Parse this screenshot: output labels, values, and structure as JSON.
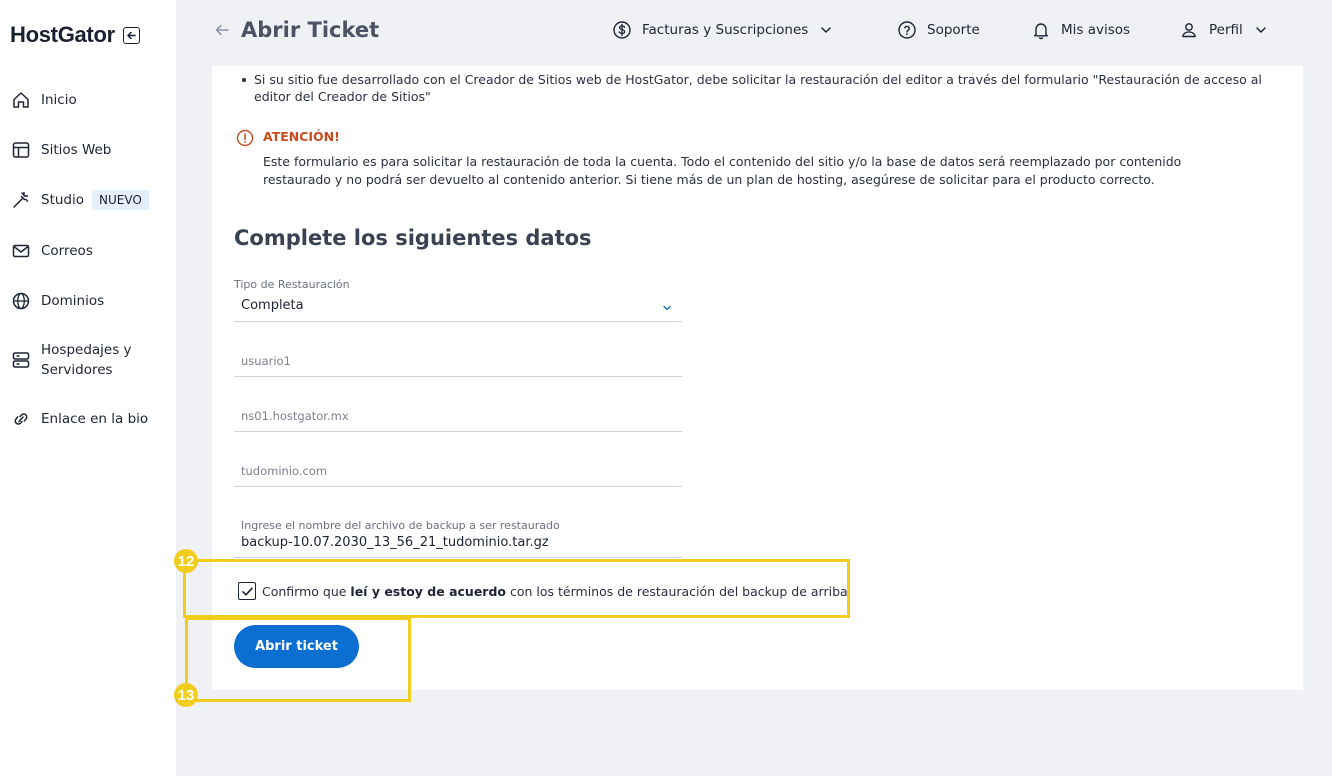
{
  "brand": {
    "name": "HostGator"
  },
  "sidebar": {
    "items": [
      {
        "label": "Inicio",
        "icon": "home-icon"
      },
      {
        "label": "Sitios Web",
        "icon": "layout-icon"
      },
      {
        "label": "Studio",
        "icon": "magic-wand-icon",
        "badge": "NUEVO"
      },
      {
        "label": "Correos",
        "icon": "mail-icon"
      },
      {
        "label": "Dominios",
        "icon": "globe-icon"
      },
      {
        "label": "Hospedajes y Servidores",
        "line1": "Hospedajes y",
        "line2": "Servidores",
        "icon": "server-icon"
      },
      {
        "label": "Enlace en la bio",
        "icon": "link-icon"
      }
    ]
  },
  "header": {
    "title": "Abrir Ticket",
    "billing": "Facturas y Suscripciones",
    "support": "Soporte",
    "notices": "Mis avisos",
    "profile": "Perfil"
  },
  "content": {
    "bullet": "Si su sitio fue desarrollado con el Creador de Sitios web de HostGator, debe solicitar la restauración del editor a través del formulario \"Restauración de acceso al editor del Creador de Sitios\"",
    "warning_title": "ATENCIÓN!",
    "warning_body": "Este formulario es para solicitar la restauración de toda la cuenta. Todo el contenido del sitio y/o la base de datos será reemplazado por contenido restaurado y no podrá ser devuelto al contenido anterior. Si tiene más de un plan de hosting, asegúrese de solicitar para el producto correcto.",
    "section_title": "Complete los siguientes datos"
  },
  "form": {
    "restore_type_label": "Tipo de Restauración",
    "restore_type_value": "Completa",
    "user_placeholder": "usuario1",
    "ns_placeholder": "ns01.hostgator.mx",
    "domain_placeholder": "tudominio.com",
    "backup_label": "Ingrese el nombre del archivo de backup a ser restaurado",
    "backup_value": "backup-10.07.2030_13_56_21_tudominio.tar.gz",
    "confirm_pre": "Confirmo que ",
    "confirm_bold": "leí y estoy de acuerdo",
    "confirm_post": " con los términos de restauración del backup de arriba.",
    "confirm_checked": true,
    "submit_label": "Abrir ticket"
  },
  "annotations": {
    "step12": "12",
    "step13": "13",
    "color": "#f1cd1d"
  },
  "colors": {
    "primary": "#0b6fd1",
    "warning": "#c94b1e",
    "badge_bg": "#e6effc",
    "page_bg": "#f0f1f5"
  }
}
